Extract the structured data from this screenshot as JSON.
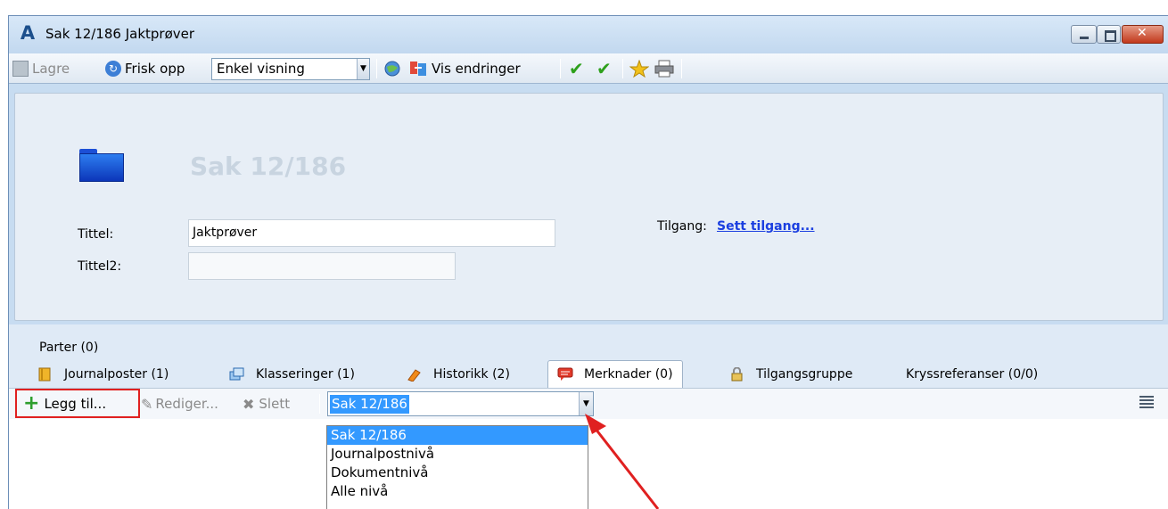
{
  "window": {
    "title": "Sak 12/186 Jaktprøver",
    "app_icon_letter": "A"
  },
  "toolbar": {
    "save_label": "Lagre",
    "refresh_label": "Frisk opp",
    "view_select_value": "Enkel visning",
    "show_changes_label": "Vis endringer"
  },
  "header": {
    "case_title": "Sak 12/186",
    "tittel_label": "Tittel:",
    "tittel_value": "Jaktprøver",
    "tittel2_label": "Tittel2:",
    "tittel2_value": "",
    "access_label": "Tilgang:",
    "access_link": "Sett tilgang..."
  },
  "lower": {
    "parter_label": "Parter (0)",
    "tabs": [
      {
        "label": "Journalposter (1)",
        "icon": "journal-icon"
      },
      {
        "label": "Klasseringer (1)",
        "icon": "classification-icon"
      },
      {
        "label": "Historikk (2)",
        "icon": "history-icon"
      },
      {
        "label": "Merknader (0)",
        "icon": "comment-icon",
        "active": true
      },
      {
        "label": "Tilgangsgruppe",
        "icon": "lock-icon"
      },
      {
        "label": "Kryssreferanser (0/0)",
        "icon": ""
      }
    ]
  },
  "subtoolbar": {
    "add_label": "Legg til...",
    "edit_label": "Rediger...",
    "delete_label": "Slett",
    "level_select_value": "Sak 12/186",
    "level_options": [
      "Sak 12/186",
      "Journalpostnivå",
      "Dokumentnivå",
      "Alle nivå"
    ]
  },
  "colors": {
    "accent": "#3399ff",
    "annotation_red": "#e02020",
    "link_blue": "#1b3fe0"
  }
}
